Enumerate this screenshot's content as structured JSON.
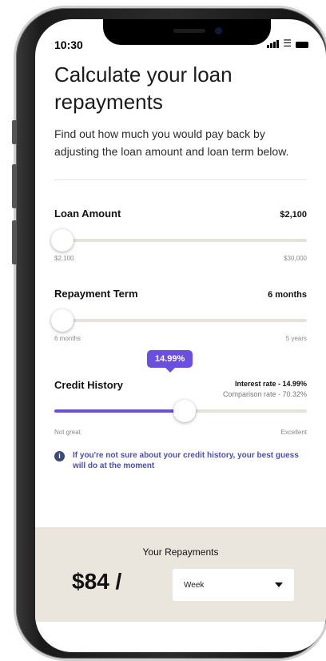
{
  "status_bar": {
    "time": "10:30"
  },
  "title": "Calculate your loan repayments",
  "intro": "Find out how much you would pay back by adjusting the loan amount and loan term below.",
  "loan_amount": {
    "label": "Loan Amount",
    "value": "$2,100",
    "min": "$2,100",
    "max": "$30,000",
    "position": 0.0
  },
  "repayment_term": {
    "label": "Repayment Term",
    "value": "6 months",
    "min": "6 months",
    "max": "5 years",
    "position": 0.0
  },
  "credit_history": {
    "label": "Credit History",
    "tooltip": "14.99%",
    "interest_rate": "Interest rate - 14.99%",
    "comparison_rate": "Comparison rate - 70.32%",
    "min": "Not great",
    "max": "Excellent",
    "position": 0.5
  },
  "info": {
    "icon": "info-icon",
    "text": "If you're not sure about your credit history, your best guess will do at the moment"
  },
  "repayments": {
    "title": "Your Repayments",
    "amount": "$84 /",
    "frequency": "Week"
  },
  "colors": {
    "accent": "#6a4fe0",
    "panel": "#ebe6dd"
  }
}
